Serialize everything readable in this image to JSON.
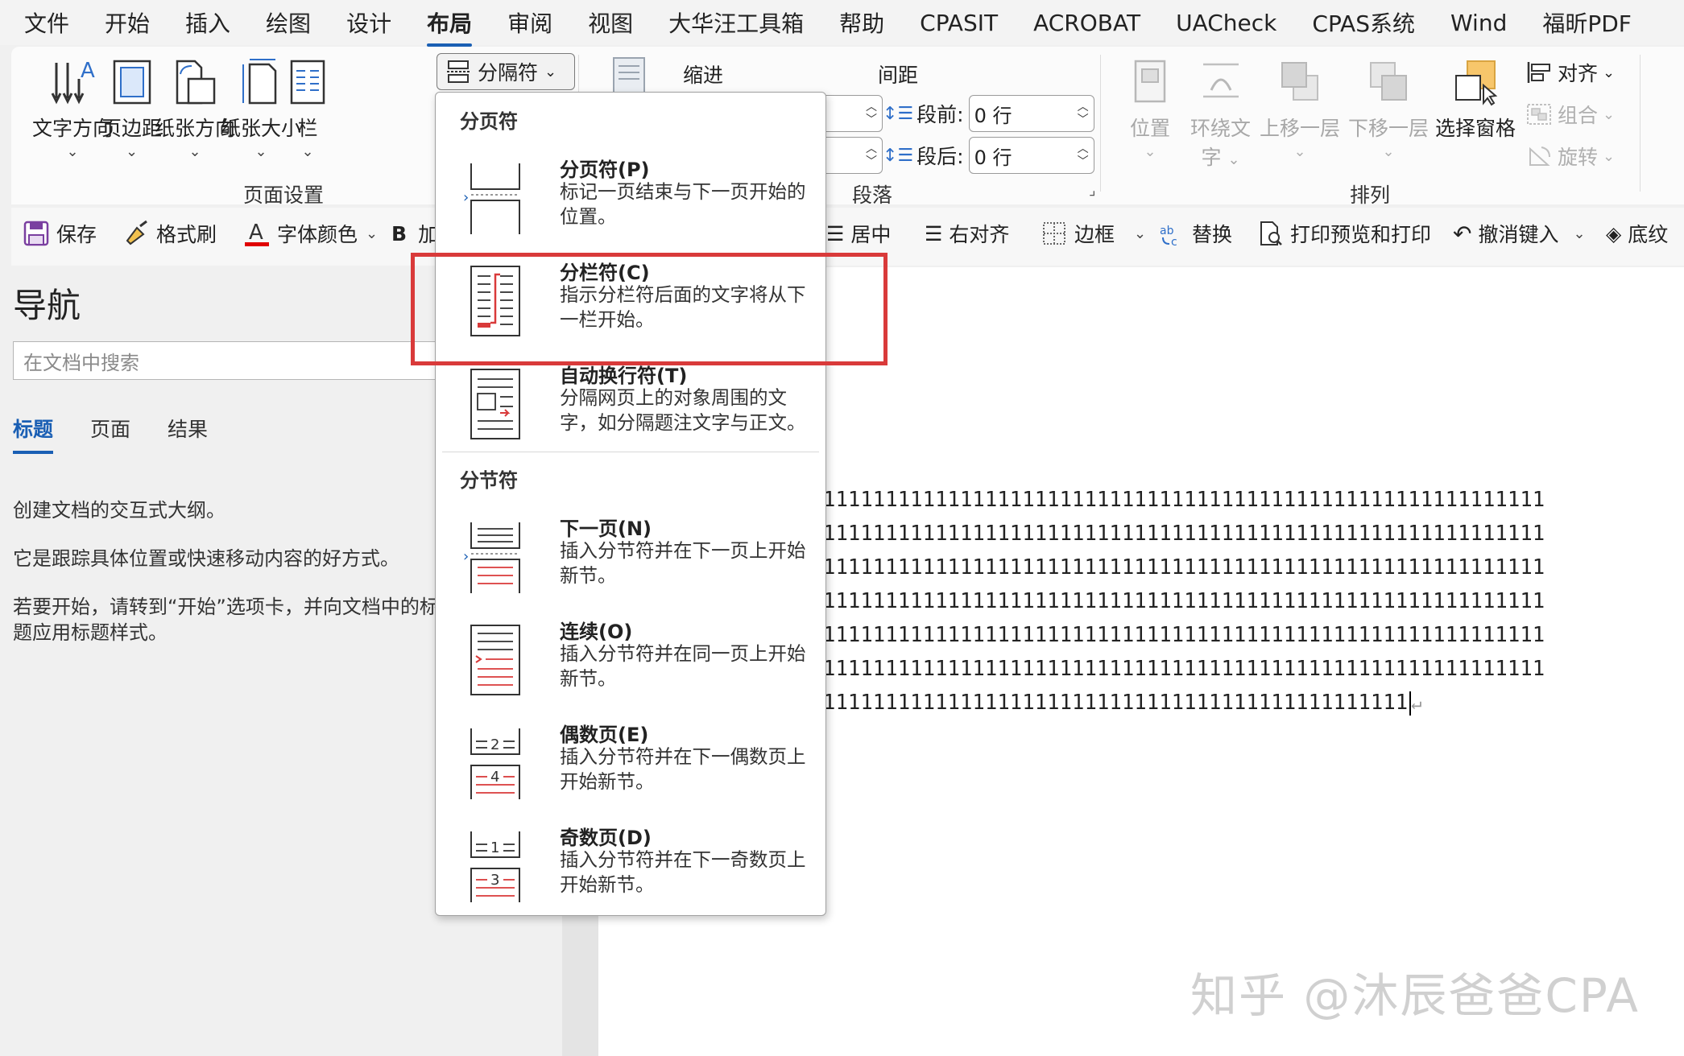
{
  "menu": {
    "tabs": [
      "文件",
      "开始",
      "插入",
      "绘图",
      "设计",
      "布局",
      "审阅",
      "视图",
      "大华汪工具箱",
      "帮助",
      "CPASIT",
      "ACROBAT",
      "UACheck",
      "CPAS系统",
      "Wind",
      "福昕PDF"
    ],
    "active": "布局"
  },
  "ribbon": {
    "text_direction": "文字方向",
    "margins": "页边距",
    "orientation": "纸张方向",
    "size": "纸张大小",
    "columns": "栏",
    "breaks": "分隔符",
    "page_setup_label": "页面设置",
    "indent_label": "缩进",
    "spacing_label": "间距",
    "before_label": "段前:",
    "before_value": "0 行",
    "after_label": "段后:",
    "after_value": "0 行",
    "paragraph_label": "段落",
    "position": "位置",
    "wrap_text_1": "环绕文",
    "wrap_text_2": "字",
    "bring_forward": "上移一层",
    "send_backward": "下移一层",
    "selection_pane": "选择窗格",
    "align": "对齐",
    "group": "组合",
    "rotate": "旋转",
    "arrange_label": "排列"
  },
  "qat": {
    "save": "保存",
    "format_painter": "格式刷",
    "font_color": "字体颜色",
    "bold_prefix": "B",
    "bold_label": "加",
    "center": "居中",
    "align_right": "右对齐",
    "borders": "边框",
    "replace": "替换",
    "print_preview": "打印预览和打印",
    "undo": "撤消键入",
    "shading": "底纹"
  },
  "nav": {
    "title": "导航",
    "search_placeholder": "在文档中搜索",
    "tabs": [
      "标题",
      "页面",
      "结果"
    ],
    "para1": "创建文档的交互式大纲。",
    "para2": "它是跟踪具体位置或快速移动内容的好方式。",
    "para3": "若要开始，请转到“开始”选项卡，并向文档中的标题应用标题样式。"
  },
  "dropdown": {
    "section1": "分页符",
    "section2": "分节符",
    "items": [
      {
        "name": "分页符(P)",
        "desc": "标记一页结束与下一页开始的位置。"
      },
      {
        "name": "分栏符(C)",
        "desc": "指示分栏符后面的文字将从下一栏开始。"
      },
      {
        "name": "自动换行符(T)",
        "desc": "分隔网页上的对象周围的文字，如分隔题注文字与正文。"
      },
      {
        "name": "下一页(N)",
        "desc": "插入分节符并在下一页上开始新节。"
      },
      {
        "name": "连续(O)",
        "desc": "插入分节符并在同一页上开始新节。"
      },
      {
        "name": "偶数页(E)",
        "desc": "插入分节符并在下一偶数页上开始新节。"
      },
      {
        "name": "奇数页(D)",
        "desc": "插入分节符并在下一奇数页上开始新节。"
      }
    ]
  },
  "document": {
    "lines": [
      "1111111111111111111111111111111111111111111111111111111111",
      "1111111111111111111111111111111111111111111111111111111111",
      "1111111111111111111111111111111111111111111111111111111111",
      "1111111111111111111111111111111111111111111111111111111111",
      "1111111111111111111111111111111111111111111111111111111111",
      "1111111111111111111111111111111111111111111111111111111111",
      "11111111111111111111111111111111111111111111111"
    ]
  },
  "watermark": "知乎 @沐辰爸爸CPA",
  "colors": {
    "accent": "#1a5fb4",
    "highlight_box": "#d93a3a",
    "icon_red": "#d93a3a"
  }
}
